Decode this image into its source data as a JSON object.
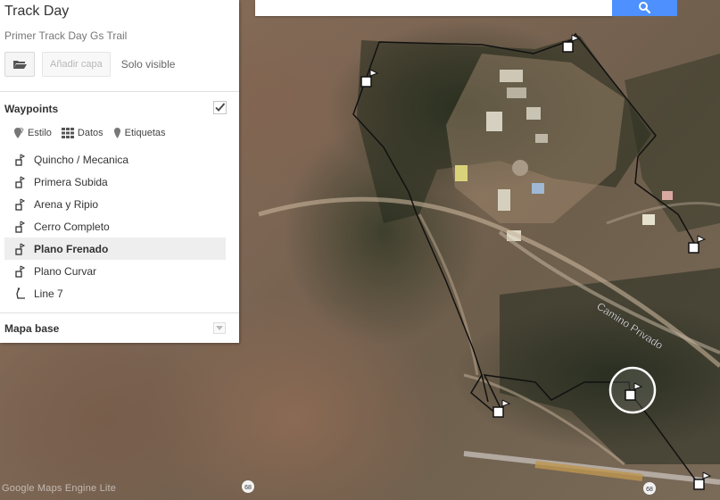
{
  "map_title": "Track Day",
  "map_description": "Primer Track Day Gs Trail",
  "toolbar": {
    "add_layer_label": "Añadir capa",
    "visible_label": "Solo visible"
  },
  "search": {
    "placeholder": "",
    "value": ""
  },
  "layer": {
    "title": "Waypoints",
    "checked": true,
    "options": {
      "style": "Estilo",
      "data": "Datos",
      "labels": "Etiquetas"
    },
    "items": [
      {
        "label": "Quincho / Mecanica",
        "icon": "flag-marker-icon"
      },
      {
        "label": "Primera Subida",
        "icon": "flag-marker-icon"
      },
      {
        "label": "Arena y Ripio",
        "icon": "flag-marker-icon"
      },
      {
        "label": "Cerro Completo",
        "icon": "flag-marker-icon"
      },
      {
        "label": "Plano Frenado",
        "icon": "flag-marker-icon",
        "selected": true
      },
      {
        "label": "Plano Curvar",
        "icon": "flag-marker-icon"
      },
      {
        "label": "Line 7",
        "icon": "line-path-icon"
      }
    ]
  },
  "base_map": {
    "title": "Mapa base"
  },
  "map": {
    "road_label": "Camino Privado",
    "route_shields": [
      "68",
      "68"
    ],
    "attribution": "Google Maps Engine Lite"
  },
  "colors": {
    "search_button": "#4d90fe",
    "track_line": "#111111",
    "selection_ring": "#ffffff"
  }
}
